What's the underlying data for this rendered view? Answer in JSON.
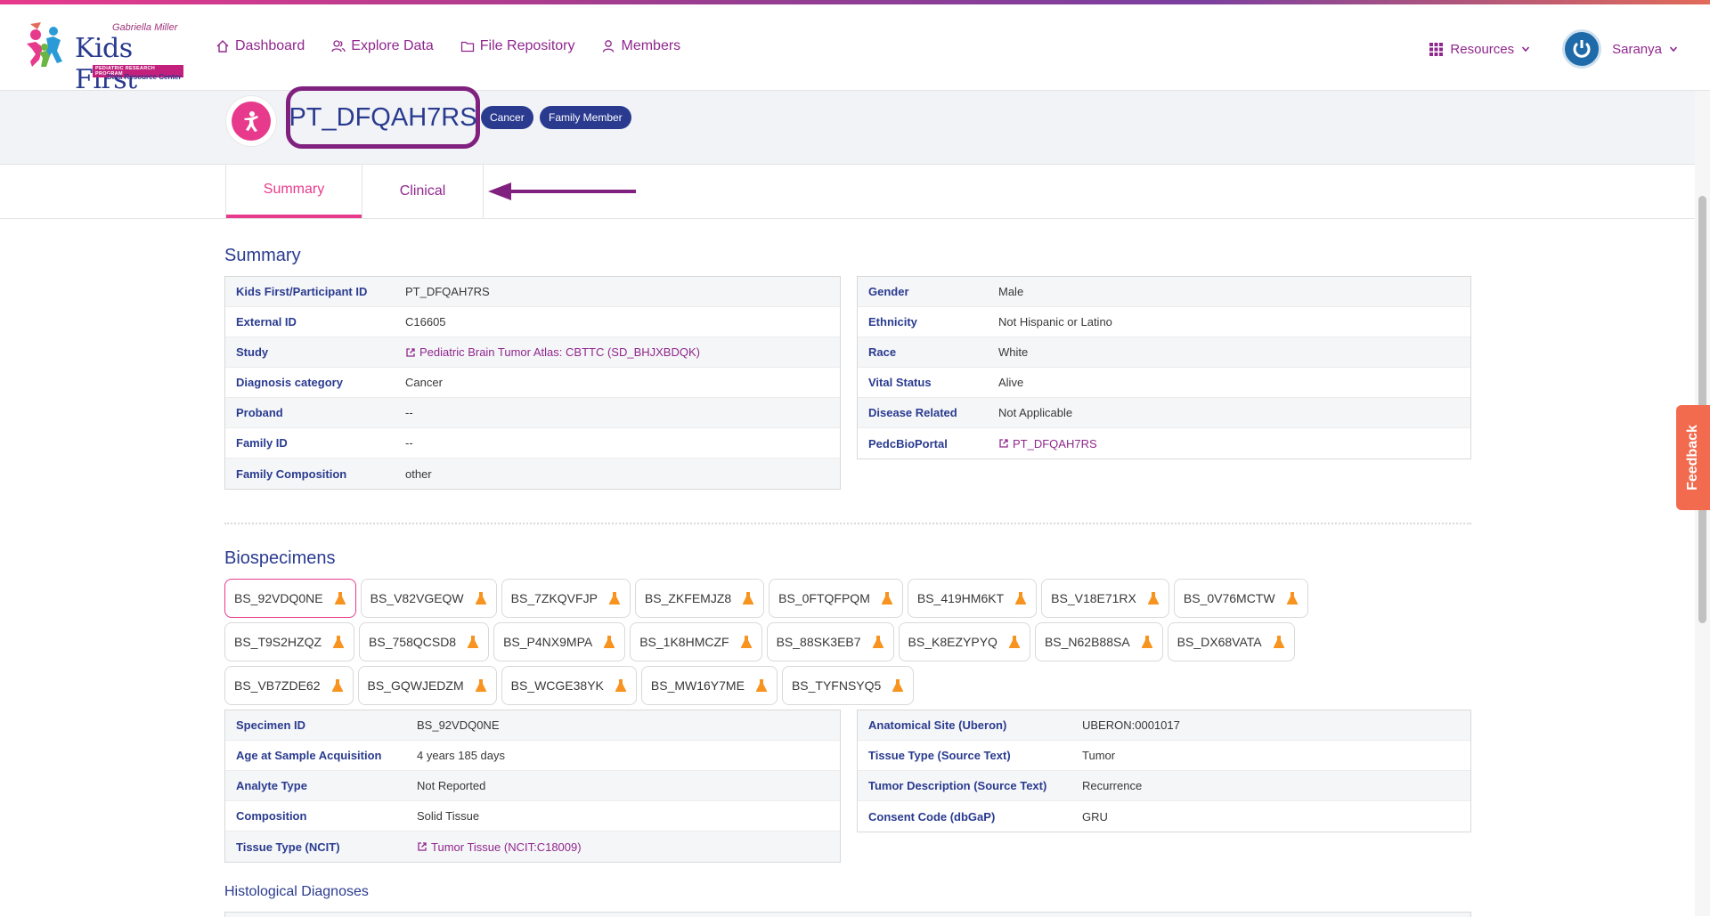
{
  "header": {
    "logo": {
      "top_text": "Gabriella Miller",
      "main_text": "Kids First",
      "program_text": "PEDIATRIC RESEARCH PROGRAM",
      "sub_text": "Data Resource Center"
    },
    "nav": [
      {
        "label": "Dashboard",
        "icon": "home-icon"
      },
      {
        "label": "Explore Data",
        "icon": "users-icon"
      },
      {
        "label": "File Repository",
        "icon": "folder-icon"
      },
      {
        "label": "Members",
        "icon": "user-icon"
      }
    ],
    "resources_label": "Resources",
    "user_name": "Saranya"
  },
  "entity": {
    "id": "PT_DFQAH7RS",
    "tags": [
      "Cancer",
      "Family Member"
    ]
  },
  "tabs": [
    {
      "label": "Summary",
      "active": true
    },
    {
      "label": "Clinical",
      "active": false
    }
  ],
  "summary": {
    "title": "Summary",
    "left": [
      {
        "key": "Kids First/Participant ID",
        "value": "PT_DFQAH7RS"
      },
      {
        "key": "External ID",
        "value": "C16605"
      },
      {
        "key": "Study",
        "value": "Pediatric Brain Tumor Atlas: CBTTC (SD_BHJXBDQK)",
        "link": true
      },
      {
        "key": "Diagnosis category",
        "value": "Cancer"
      },
      {
        "key": "Proband",
        "value": "--"
      },
      {
        "key": "Family ID",
        "value": "--"
      },
      {
        "key": "Family Composition",
        "value": "other"
      }
    ],
    "right": [
      {
        "key": "Gender",
        "value": "Male"
      },
      {
        "key": "Ethnicity",
        "value": "Not Hispanic or Latino"
      },
      {
        "key": "Race",
        "value": "White"
      },
      {
        "key": "Vital Status",
        "value": "Alive"
      },
      {
        "key": "Disease Related",
        "value": "Not Applicable"
      },
      {
        "key": "PedcBioPortal",
        "value": "PT_DFQAH7RS",
        "link": true
      }
    ]
  },
  "biospecimens": {
    "title": "Biospecimens",
    "rows": [
      [
        "BS_92VDQ0NE",
        "BS_V82VGEQW",
        "BS_7ZKQVFJP",
        "BS_ZKFEMJZ8",
        "BS_0FTQFPQM",
        "BS_419HM6KT",
        "BS_V18E71RX",
        "BS_0V76MCTW"
      ],
      [
        "BS_T9S2HZQZ",
        "BS_758QCSD8",
        "BS_P4NX9MPA",
        "BS_1K8HMCZF",
        "BS_88SK3EB7",
        "BS_K8EZYPYQ",
        "BS_N62B88SA",
        "BS_DX68VATA"
      ],
      [
        "BS_VB7ZDE62",
        "BS_GQWJEDZM",
        "BS_WCGE38YK",
        "BS_MW16Y7ME",
        "BS_TYFNSYQ5"
      ]
    ],
    "selected": "BS_92VDQ0NE",
    "left": [
      {
        "key": "Specimen ID",
        "value": "BS_92VDQ0NE"
      },
      {
        "key": "Age at Sample Acquisition",
        "value": "4 years 185 days"
      },
      {
        "key": "Analyte Type",
        "value": "Not Reported"
      },
      {
        "key": "Composition",
        "value": "Solid Tissue"
      },
      {
        "key": "Tissue Type (NCIT)",
        "value": "Tumor Tissue (NCIT:C18009)",
        "link": true
      }
    ],
    "right": [
      {
        "key": "Anatomical Site (Uberon)",
        "value": "UBERON:0001017"
      },
      {
        "key": "Tissue Type (Source Text)",
        "value": "Tumor"
      },
      {
        "key": "Tumor Description (Source Text)",
        "value": "Recurrence"
      },
      {
        "key": "Consent Code (dbGaP)",
        "value": "GRU"
      }
    ]
  },
  "histological": {
    "title": "Histological Diagnoses"
  },
  "feedback_label": "Feedback",
  "colors": {
    "primary": "#2a3b8f",
    "accent": "#90278e",
    "pink": "#e83a8c",
    "feedback": "#f26b4f",
    "flask": "#f7931e"
  }
}
